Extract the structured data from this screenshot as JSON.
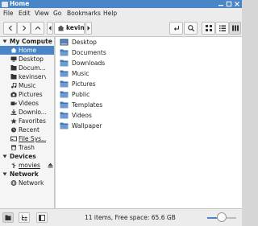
{
  "window": {
    "title": "Home",
    "accent": "#4a85c8"
  },
  "menu": [
    "File",
    "Edit",
    "View",
    "Go",
    "Bookmarks",
    "Help"
  ],
  "toolbar": {
    "path_label": "kevin"
  },
  "sidebar": {
    "sections": [
      {
        "label": "My Compute",
        "items": [
          {
            "label": "Home",
            "icon": "home-icon",
            "selected": true
          },
          {
            "label": "Desktop",
            "icon": "desktop-icon"
          },
          {
            "label": "Docum...",
            "icon": "documents-icon"
          },
          {
            "label": "kevinserv",
            "icon": "folder-icon"
          },
          {
            "label": "Music",
            "icon": "music-icon"
          },
          {
            "label": "Pictures",
            "icon": "pictures-icon"
          },
          {
            "label": "Videos",
            "icon": "videos-icon"
          },
          {
            "label": "Downlo...",
            "icon": "downloads-icon"
          },
          {
            "label": "Favorites",
            "icon": "star-icon"
          },
          {
            "label": "Recent",
            "icon": "clock-icon"
          },
          {
            "label": "File Sys...",
            "icon": "drive-icon",
            "underline": true
          },
          {
            "label": "Trash",
            "icon": "trash-icon"
          }
        ]
      },
      {
        "label": "Devices",
        "items": [
          {
            "label": "movies",
            "icon": "usb-icon",
            "underline": true
          }
        ]
      },
      {
        "label": "Network",
        "items": [
          {
            "label": "Network",
            "icon": "network-icon"
          }
        ]
      }
    ]
  },
  "files": [
    {
      "name": "Desktop",
      "icon": "desktop-folder-icon"
    },
    {
      "name": "Documents",
      "icon": "folder-icon"
    },
    {
      "name": "Downloads",
      "icon": "folder-icon"
    },
    {
      "name": "Music",
      "icon": "folder-icon"
    },
    {
      "name": "Pictures",
      "icon": "folder-icon"
    },
    {
      "name": "Public",
      "icon": "folder-icon"
    },
    {
      "name": "Templates",
      "icon": "folder-icon"
    },
    {
      "name": "Videos",
      "icon": "folder-icon"
    },
    {
      "name": "Wallpaper",
      "icon": "folder-icon"
    }
  ],
  "status": {
    "text": "11 items, Free space: 65.6 GB"
  },
  "zoom": {
    "level": 0.5
  }
}
